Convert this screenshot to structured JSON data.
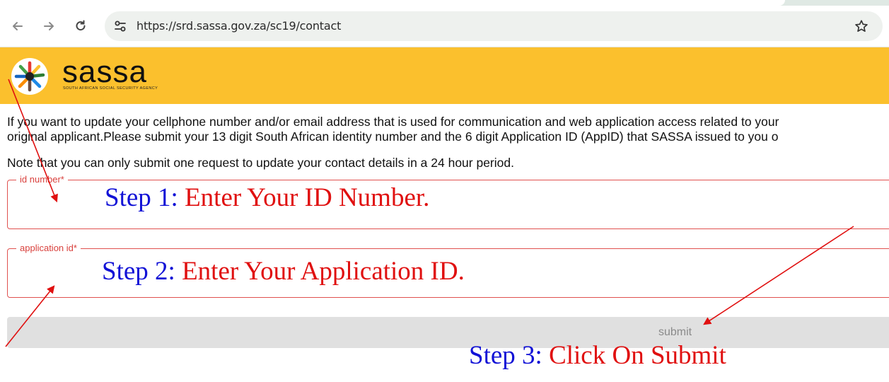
{
  "browser": {
    "url": "https://srd.sassa.gov.za/sc19/contact"
  },
  "header": {
    "brand": "sassa",
    "subtitle": "SOUTH AFRICAN SOCIAL SECURITY AGENCY"
  },
  "content": {
    "intro_line1": "If you want to update your cellphone number and/or email address that is used for communication and web application access related to your",
    "intro_line2": "original applicant.Please submit your 13 digit South African identity number and the 6 digit Application ID (AppID) that SASSA issued to you o",
    "note": "Note that you can only submit one request to update your contact details in a 24 hour period."
  },
  "form": {
    "id_label": "id number*",
    "app_label": "application id*",
    "submit_label": "submit"
  },
  "annotations": {
    "step1_label": "Step 1:",
    "step1_text": "Enter Your ID Number.",
    "step2_label": "Step 2:",
    "step2_text": "Enter Your Application ID.",
    "step3_label": "Step 3:",
    "step3_text": "Click On Submit"
  },
  "colors": {
    "header_bg": "#fbc02d",
    "field_border": "#e0514f",
    "step_label": "#1212d6",
    "step_text": "#e01010"
  }
}
